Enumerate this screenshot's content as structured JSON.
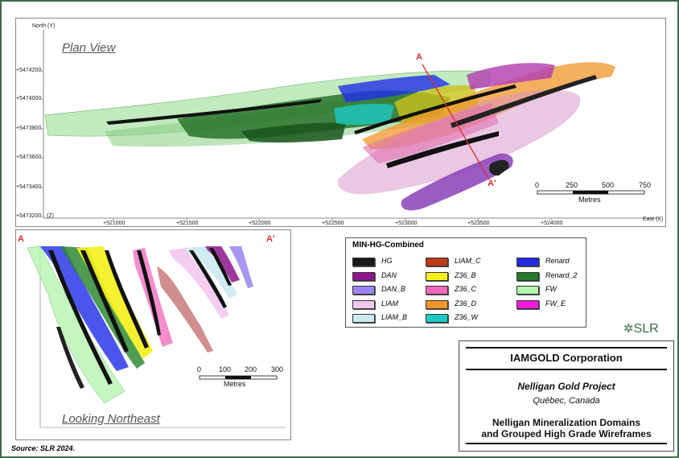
{
  "plan_view": {
    "title": "Plan View",
    "north_label": "North (Y)",
    "east_label": "East (X)",
    "y_ticks": [
      "+5474200",
      "+5474000",
      "+5473800",
      "+5473600",
      "+5473400",
      "+5473200"
    ],
    "z_label": "(Z)",
    "x_ticks": [
      "+521000",
      "+521500",
      "+522000",
      "+522500",
      "+523000",
      "+523500",
      "+524000"
    ],
    "section_start": "A",
    "section_end": "A'",
    "scale": {
      "labels": [
        "0",
        "250",
        "500",
        "750"
      ],
      "unit": "Metres"
    }
  },
  "section_view": {
    "title": "Looking Northeast",
    "left_mark": "A",
    "right_mark": "A'",
    "scale": {
      "labels": [
        "0",
        "100",
        "200",
        "300"
      ],
      "unit": "Metres"
    }
  },
  "legend": {
    "title": "MIN-HG-Combined",
    "items": [
      {
        "label": "HG",
        "color": "#1a1a1a"
      },
      {
        "label": "DAN",
        "color": "#8c168c"
      },
      {
        "label": "DAN_B",
        "color": "#9a84f0"
      },
      {
        "label": "LIAM",
        "color": "#f3c8ef"
      },
      {
        "label": "LIAM_B",
        "color": "#cbe9f0"
      },
      {
        "label": "LIAM_C",
        "color": "#c23a12"
      },
      {
        "label": "Z36_B",
        "color": "#f5f01a"
      },
      {
        "label": "Z36_C",
        "color": "#f266be"
      },
      {
        "label": "Z36_D",
        "color": "#f0962a"
      },
      {
        "label": "Z36_W",
        "color": "#1ec9c4"
      },
      {
        "label": "Renard",
        "color": "#1f2ee6"
      },
      {
        "label": "Renard_2",
        "color": "#247a2a"
      },
      {
        "label": "FW",
        "color": "#b5f5b0"
      },
      {
        "label": "FW_E",
        "color": "#f01ad9"
      }
    ]
  },
  "title_block": {
    "company": "IAMGOLD Corporation",
    "project": "Nelligan Gold Project",
    "location": "Québec, Canada",
    "figure_title_1": "Nelligan Mineralization Domains",
    "figure_title_2": "and Grouped High Grade Wireframes"
  },
  "logo": {
    "text": "SLR"
  },
  "source": "Source:  SLR 2024."
}
